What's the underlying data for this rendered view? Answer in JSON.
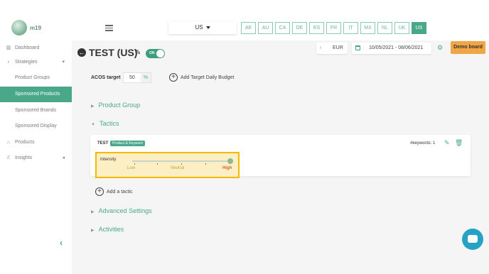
{
  "app": {
    "logo_text": "m19"
  },
  "header": {
    "country_select": "US",
    "marketplaces": [
      {
        "label": "AE",
        "active": false
      },
      {
        "label": "AU",
        "active": false
      },
      {
        "label": "CA",
        "active": false
      },
      {
        "label": "DE",
        "active": false
      },
      {
        "label": "ES",
        "active": false
      },
      {
        "label": "FR",
        "active": false
      },
      {
        "label": "IT",
        "active": false
      },
      {
        "label": "MX",
        "active": false
      },
      {
        "label": "NL",
        "active": false
      },
      {
        "label": "UK",
        "active": false
      },
      {
        "label": "US",
        "active": true
      }
    ]
  },
  "sidebar": {
    "dashboard": "Dashboard",
    "strategies": "Strategies",
    "product_groups": "Product Groups",
    "sponsored_products": "Sponsored Products",
    "sponsored_brands": "Sponsored Brands",
    "sponsored_display": "Sponsored Display",
    "products": "Products",
    "insights": "Insights"
  },
  "page": {
    "title": "TEST (US)",
    "toggle_label": "ON",
    "currency": "EUR",
    "date_range": "10/05/2021 - 08/06/2021",
    "demo_board": "Demo board"
  },
  "acos": {
    "label": "ACOS target",
    "value": "50",
    "unit": "%"
  },
  "add_budget_label": "Add Target Daily Budget",
  "sections": {
    "product_group": "Product Group",
    "tactics": "Tactics",
    "advanced_settings": "Advanced Settings",
    "activities": "Activities"
  },
  "tactic": {
    "name": "TEST",
    "badge": "Product & Keyword",
    "keywords": "#keywords: 1",
    "intensity_label": "Intensity",
    "intensity_low": "Low",
    "intensity_neutral": "Neutral",
    "intensity_high": "High",
    "intensity_level": 1.0
  },
  "add_tactic_label": "Add a tactic",
  "colors": {
    "accent": "#4aa88a",
    "highlight": "#f5b800",
    "demo": "#f0a645",
    "chat": "#26a3c4"
  }
}
